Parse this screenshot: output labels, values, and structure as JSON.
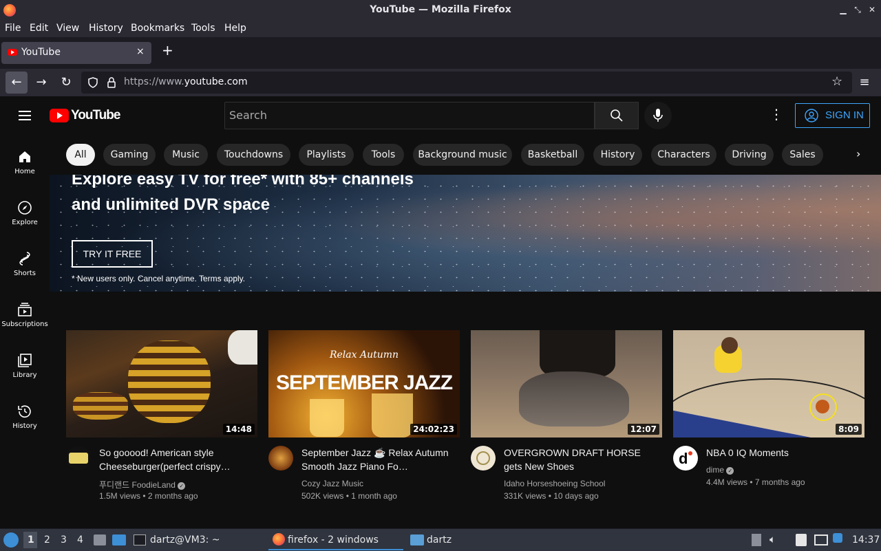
{
  "window": {
    "title": "YouTube — Mozilla Firefox",
    "min_icon": "minimize-icon",
    "max_icon": "maximize-icon",
    "close_icon": "close-icon"
  },
  "menu": [
    "File",
    "Edit",
    "View",
    "History",
    "Bookmarks",
    "Tools",
    "Help"
  ],
  "tab": {
    "label": "YouTube",
    "close": "×",
    "new": "+"
  },
  "nav": {
    "url_prefix": "https://www.",
    "url_domain": "youtube.com"
  },
  "yt": {
    "logo_text": "YouTube",
    "search_placeholder": "Search",
    "sign_in": "SIGN IN",
    "sidebar": [
      "Home",
      "Explore",
      "Shorts",
      "Subscriptions",
      "Library",
      "History"
    ],
    "chips": [
      "All",
      "Gaming",
      "Music",
      "Touchdowns",
      "Playlists",
      "Tools",
      "Background music",
      "Basketball",
      "History",
      "Characters",
      "Driving",
      "Sales"
    ],
    "banner": {
      "title": "Explore easy TV for free* with 85+ channels and unlimited DVR space",
      "cta": "TRY IT FREE",
      "note": "* New users only. Cancel anytime. Terms apply."
    },
    "videos": [
      {
        "title": "So gooood! American style Cheeseburger(perfect crispy…",
        "channel": "푸디랜드 FoodieLand",
        "verified": true,
        "meta": "1.5M views • 2 months ago",
        "duration": "14:48"
      },
      {
        "title": "September Jazz ☕ Relax Autumn Smooth Jazz Piano Fo…",
        "channel": "Cozy Jazz Music",
        "verified": false,
        "meta": "502K views • 1 month ago",
        "duration": "24:02:23",
        "thumb_text": "SEPTEMBER JAZZ",
        "thumb_script": "Relax Autumn"
      },
      {
        "title": "OVERGROWN DRAFT HORSE gets New Shoes",
        "channel": "Idaho Horseshoeing School",
        "verified": false,
        "meta": "331K views • 10 days ago",
        "duration": "12:07"
      },
      {
        "title": "NBA 0 IQ Moments",
        "channel": "dime",
        "verified": true,
        "meta": "4.4M views • 7 months ago",
        "duration": "8:09"
      }
    ]
  },
  "taskbar": {
    "workspaces": [
      "1",
      "2",
      "3",
      "4"
    ],
    "terminal": "dartz@VM3: ~",
    "firefox": "firefox - 2 windows",
    "folder": "dartz",
    "clock": "14:37"
  }
}
